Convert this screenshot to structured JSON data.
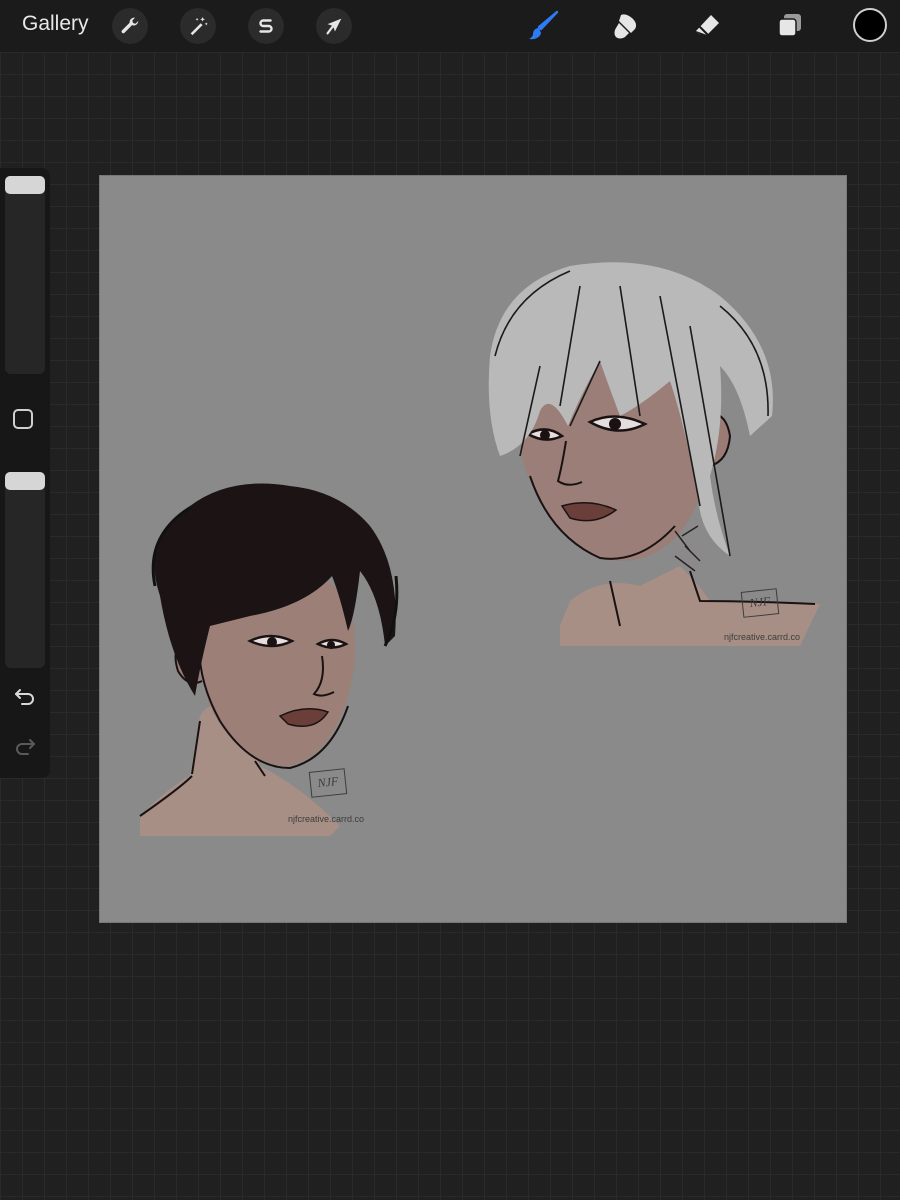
{
  "topbar": {
    "gallery_label": "Gallery",
    "left_tools": [
      {
        "name": "actions",
        "icon": "wrench-icon"
      },
      {
        "name": "adjustments",
        "icon": "magic-wand-icon"
      },
      {
        "name": "selection",
        "icon": "selection-s-icon"
      },
      {
        "name": "transform",
        "icon": "arrow-cursor-icon"
      }
    ],
    "right_tools": [
      {
        "name": "brush",
        "icon": "brush-icon",
        "active": true
      },
      {
        "name": "smudge",
        "icon": "smudge-icon"
      },
      {
        "name": "eraser",
        "icon": "eraser-icon"
      },
      {
        "name": "layers",
        "icon": "layers-icon"
      }
    ],
    "current_color": "#000000",
    "active_tool_color": "#2f7bf5"
  },
  "sidebar": {
    "brush_size_level": 0.0,
    "opacity_level": 0.0,
    "icons": [
      "modify-square-icon",
      "undo-icon",
      "redo-icon"
    ]
  },
  "canvas": {
    "background_color": "#8a8a8a",
    "watermarks": [
      {
        "mark": "NJF",
        "text": "njfcreative.carrd.co"
      },
      {
        "mark": "NJF",
        "text": "njfcreative.carrd.co"
      }
    ]
  }
}
